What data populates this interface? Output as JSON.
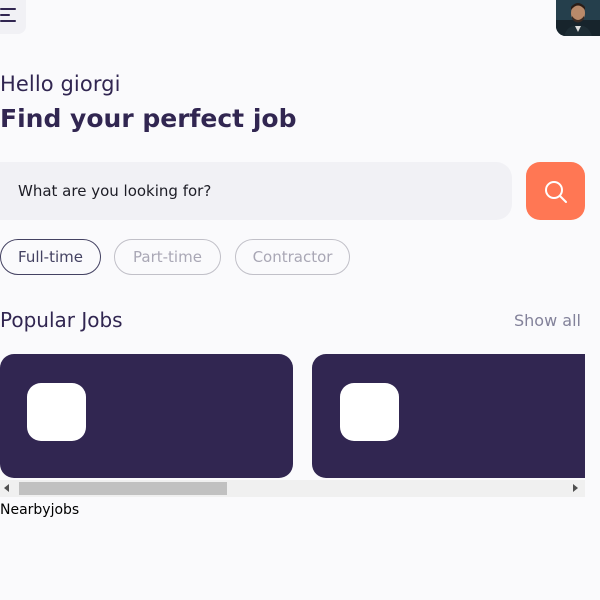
{
  "header": {
    "menu_icon": "menu-icon",
    "avatar_icon": "user-avatar"
  },
  "welcome": {
    "greeting": "Hello giorgi",
    "headline": "Find your perfect job"
  },
  "search": {
    "placeholder": "What are you looking for?",
    "value": "",
    "button_icon": "search-icon"
  },
  "job_types": [
    {
      "label": "Full-time",
      "selected": true
    },
    {
      "label": "Part-time",
      "selected": false
    },
    {
      "label": "Contractor",
      "selected": false
    }
  ],
  "popular_jobs": {
    "title": "Popular Jobs",
    "show_all": "Show all",
    "cards_count_visible": 2
  },
  "nearby_jobs": {
    "title": "Nearbyjobs"
  },
  "colors": {
    "primary": "#312651",
    "accent": "#ff7754",
    "background": "#fafafc",
    "input_bg": "#f1f1f5",
    "muted": "#83829a"
  }
}
